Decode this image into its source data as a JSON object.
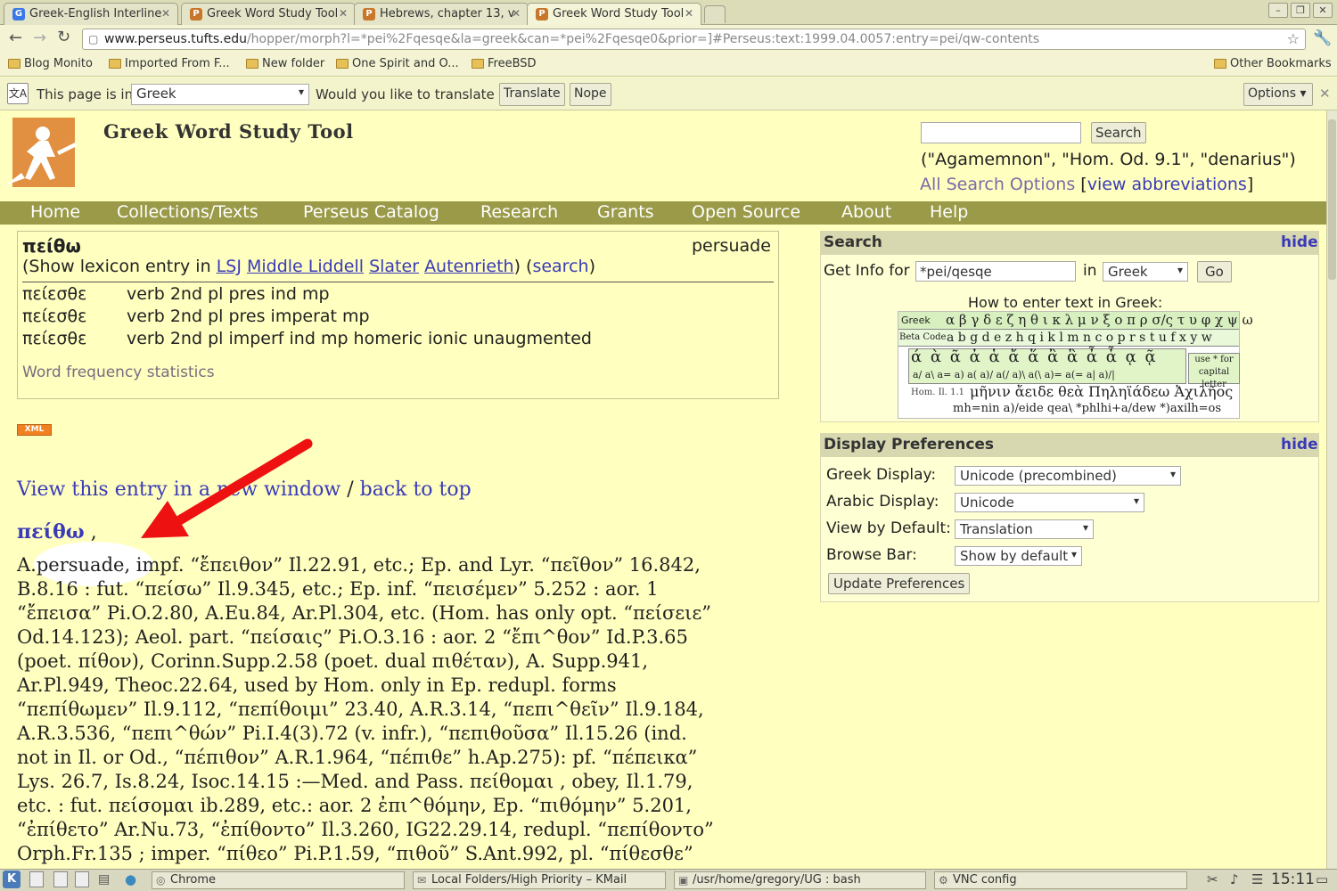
{
  "browser": {
    "tabs": [
      {
        "title": "Greek-English Interline",
        "icon": "google-icon"
      },
      {
        "title": "Greek Word Study Tool",
        "icon": "perseus-icon"
      },
      {
        "title": "Hebrews, chapter 13, v",
        "icon": "perseus-icon"
      },
      {
        "title": "Greek Word Study Tool",
        "icon": "perseus-icon"
      }
    ],
    "url_host": "www.perseus.tufts.edu",
    "url_path": "/hopper/morph?l=*pei%2Fqesqe&la=greek&can=*pei%2Fqesqe0&prior=]#Perseus:text:1999.04.0057:entry=pei/qw-contents",
    "bookmarks": [
      "Blog Monito",
      "Imported From F...",
      "New folder",
      "One Spirit and O...",
      "FreeBSD"
    ],
    "other_bookmarks": "Other Bookmarks",
    "translate": {
      "prefix": "This page is in",
      "language": "Greek",
      "question": "Would you like to translate it?",
      "translate_btn": "Translate",
      "nope_btn": "Nope",
      "options_btn": "Options"
    }
  },
  "site": {
    "title": "Greek Word Study Tool",
    "search_button": "Search",
    "search_examples": "(\"Agamemnon\", \"Hom. Od. 9.1\", \"denarius\")",
    "all_search_options": "All Search Options",
    "bracket_open": "[",
    "view_abbreviations": "view abbreviations",
    "bracket_close": "]",
    "nav": [
      "Home",
      "Collections/Texts",
      "Perseus Catalog",
      "Research",
      "Grants",
      "Open Source",
      "About",
      "Help"
    ]
  },
  "word": {
    "lemma": "πείθω",
    "gloss": "persuade",
    "show_prefix": "(Show lexicon entry in",
    "lexica": [
      "LSJ",
      "Middle Liddell",
      "Slater",
      "Autenrieth"
    ],
    "search_link": "search",
    "paren_open": "(",
    "paren_close": ")",
    "analyses": [
      {
        "form": "πείεσθε",
        "parse": "verb 2nd pl pres ind mp"
      },
      {
        "form": "πείεσθε",
        "parse": "verb 2nd pl pres imperat mp"
      },
      {
        "form": "πείεσθε",
        "parse": "verb 2nd pl imperf ind mp homeric ionic unaugmented"
      }
    ],
    "freq": "Word frequency statistics",
    "xml_badge": "XML"
  },
  "entry": {
    "view_new_window": "View this entry in a new window",
    "sep": " / ",
    "back_to_top": "back to top",
    "headword": "πείθω",
    "headword_comma": " ,",
    "lines": [
      "A.persuade, impf. “ἔπειθον” Il.22.91, etc.; Ep. and Lyr. “πεῖθον” 16.842,",
      "B.8.16 : fut. “πείσω” Il.9.345, etc.; Ep. inf. “πεισέμεν” 5.252 : aor. 1",
      "“ἔπεισα” Pi.O.2.80, A.Eu.84, Ar.Pl.304, etc. (Hom. has only opt. “πείσειε”",
      "Od.14.123); Aeol. part. “πείσαις” Pi.O.3.16 : aor. 2 “ἔπι^θον” Id.P.3.65",
      "(poet. πίθον), Corinn.Supp.2.58 (poet. dual πιθέταν), A. Supp.941,",
      "Ar.Pl.949, Theoc.22.64, used by Hom. only in Ep. redupl. forms",
      "“πεπίθωμεν” Il.9.112, “πεπίθοιμι” 23.40, A.R.3.14, “πεπι^θεῖν” Il.9.184,",
      "A.R.3.536, “πεπι^θών” Pi.I.4(3).72 (v. infr.), “πεπιθοῦσα” Il.15.26 (ind.",
      "not in Il. or Od., “πέπιθον” A.R.1.964, “πέπιθε” h.Ap.275): pf. “πέπεικα”",
      "Lys. 26.7, Is.8.24, Isoc.14.15 :—Med. and Pass. πείθομαι , obey, Il.1.79,",
      "etc. : fut. πείσομαι ib.289, etc.: aor. 2 ἐπι^θόμην, Ep. “πιθόμην” 5.201,",
      "“ἐπίθετο” Ar.Nu.73, “ἐπίθοντο” Il.3.260, IG22.29.14, redupl. “πεπίθοντο”",
      "Orph.Fr.135 ; imper. “πίθεο” Pi.P.1.59, “πιθοῦ” S.Ant.992, pl. “πίθεσθε”"
    ]
  },
  "search_panel": {
    "title": "Search",
    "hide": "hide",
    "get_info": "Get Info for",
    "query": "*pei/qesqe",
    "in": "in",
    "lang": "Greek",
    "go": "Go",
    "howto": "How to enter text in Greek:",
    "chart_rows": {
      "greek_label": "Greek",
      "greek": "α β γ δ ε ζ η θ ι κ λ μ ν ξ ο π ρ σ/ς τ υ φ χ ψ ω",
      "beta_label": "Beta Code",
      "beta": "a b g d e z h q i k l m n c o p r  s  t u f x y w",
      "accents": "ά ὰ ᾶ ἀ ἁ ἄ ἅ ἂ ἃ ἆ ἇ ᾳ ᾷ",
      "accent_codes": "a/ a\\ a= a) a( a)/ a(/ a)\\ a(\\ a)= a(= a| a)/|",
      "capital_note": "use * for capital letter",
      "example_ref": "Hom. Il. 1.1",
      "example_greek": "μῆνιν ἄειδε θεὰ Πηληϊάδεω Ἀχιλῆος",
      "example_beta": "mh=nin a)/eide qea\\ *phlhi+a/dew *)axilh=os"
    }
  },
  "prefs_panel": {
    "title": "Display Preferences",
    "hide": "hide",
    "rows": [
      {
        "label": "Greek Display:",
        "value": "Unicode (precombined)"
      },
      {
        "label": "Arabic Display:",
        "value": "Unicode"
      },
      {
        "label": "View by Default:",
        "value": "Translation"
      },
      {
        "label": "Browse Bar:",
        "value": "Show by default"
      }
    ],
    "update": "Update Preferences"
  },
  "taskbar": {
    "tasks": [
      "Chrome",
      "Local Folders/High Priority – KMail",
      "/usr/home/gregory/UG : bash",
      "VNC config"
    ],
    "clock": "15:11"
  },
  "colors": {
    "page_bg": "#ffffc0",
    "nav_bar": "#9a9a48",
    "link": "#3a3ab8",
    "arrow": "#ee1111"
  }
}
